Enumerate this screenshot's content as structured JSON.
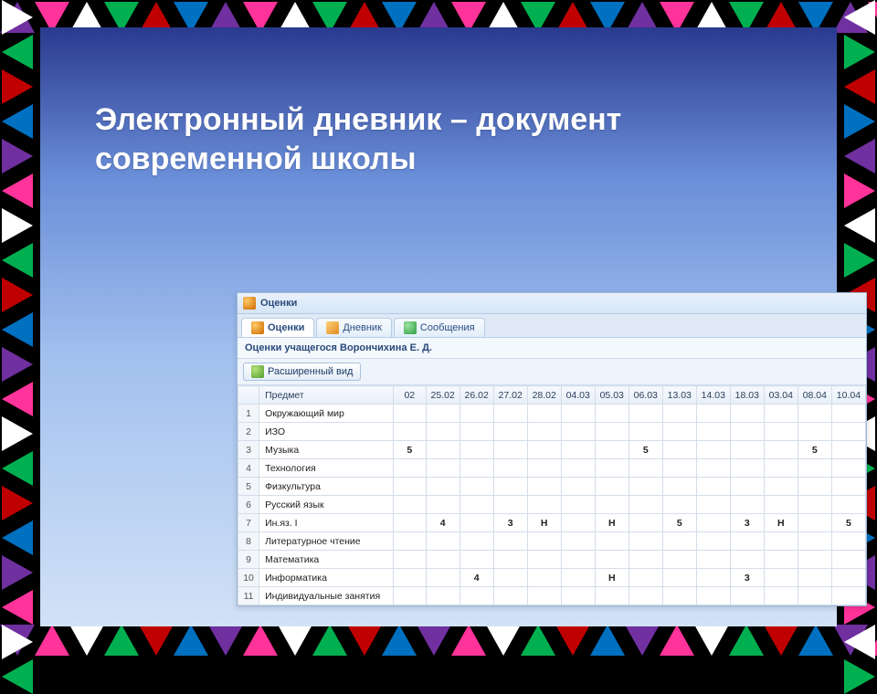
{
  "slide": {
    "title": "Электронный дневник – документ современной школы"
  },
  "window": {
    "title": "Оценки",
    "tabs": [
      {
        "label": "Оценки",
        "icon": "grades-icon",
        "active": true
      },
      {
        "label": "Дневник",
        "icon": "diary-icon",
        "active": false
      },
      {
        "label": "Сообщения",
        "icon": "messages-icon",
        "active": false
      }
    ],
    "subheader": "Оценки учащегося Ворончихина Е. Д.",
    "toolbar": {
      "expanded_view": "Расширенный вид"
    },
    "grid": {
      "subject_header": "Предмет",
      "dates": [
        "02",
        "25.02",
        "26.02",
        "27.02",
        "28.02",
        "04.03",
        "05.03",
        "06.03",
        "13.03",
        "14.03",
        "18.03",
        "03.04",
        "08.04",
        "10.04"
      ],
      "rows": [
        {
          "n": 1,
          "subject": "Окружающий мир",
          "marks": [
            "",
            "",
            "",
            "",
            "",
            "",
            "",
            "",
            "",
            "",
            "",
            "",
            "",
            ""
          ]
        },
        {
          "n": 2,
          "subject": "ИЗО",
          "marks": [
            "",
            "",
            "",
            "",
            "",
            "",
            "",
            "",
            "",
            "",
            "",
            "",
            "",
            ""
          ]
        },
        {
          "n": 3,
          "subject": "Музыка",
          "marks": [
            "5",
            "",
            "",
            "",
            "",
            "",
            "",
            "5",
            "",
            "",
            "",
            "",
            "5",
            ""
          ]
        },
        {
          "n": 4,
          "subject": "Технология",
          "marks": [
            "",
            "",
            "",
            "",
            "",
            "",
            "",
            "",
            "",
            "",
            "",
            "",
            "",
            ""
          ]
        },
        {
          "n": 5,
          "subject": "Физкультура",
          "marks": [
            "",
            "",
            "",
            "",
            "",
            "",
            "",
            "",
            "",
            "",
            "",
            "",
            "",
            ""
          ]
        },
        {
          "n": 6,
          "subject": "Русский язык",
          "marks": [
            "",
            "",
            "",
            "",
            "",
            "",
            "",
            "",
            "",
            "",
            "",
            "",
            "",
            ""
          ]
        },
        {
          "n": 7,
          "subject": "Ин.яз. I",
          "marks": [
            "",
            "4",
            "",
            "3",
            "Н",
            "",
            "Н",
            "",
            "5",
            "",
            "3",
            "Н",
            "",
            "5"
          ]
        },
        {
          "n": 8,
          "subject": "Литературное чтение",
          "marks": [
            "",
            "",
            "",
            "",
            "",
            "",
            "",
            "",
            "",
            "",
            "",
            "",
            "",
            ""
          ]
        },
        {
          "n": 9,
          "subject": "Математика",
          "marks": [
            "",
            "",
            "",
            "",
            "",
            "",
            "",
            "",
            "",
            "",
            "",
            "",
            "",
            ""
          ]
        },
        {
          "n": 10,
          "subject": "Информатика",
          "marks": [
            "",
            "",
            "4",
            "",
            "",
            "",
            "Н",
            "",
            "",
            "",
            "3",
            "",
            "",
            ""
          ]
        },
        {
          "n": 11,
          "subject": "Индивидуальные занятия",
          "marks": [
            "",
            "",
            "",
            "",
            "",
            "",
            "",
            "",
            "",
            "",
            "",
            "",
            "",
            ""
          ]
        }
      ]
    }
  }
}
